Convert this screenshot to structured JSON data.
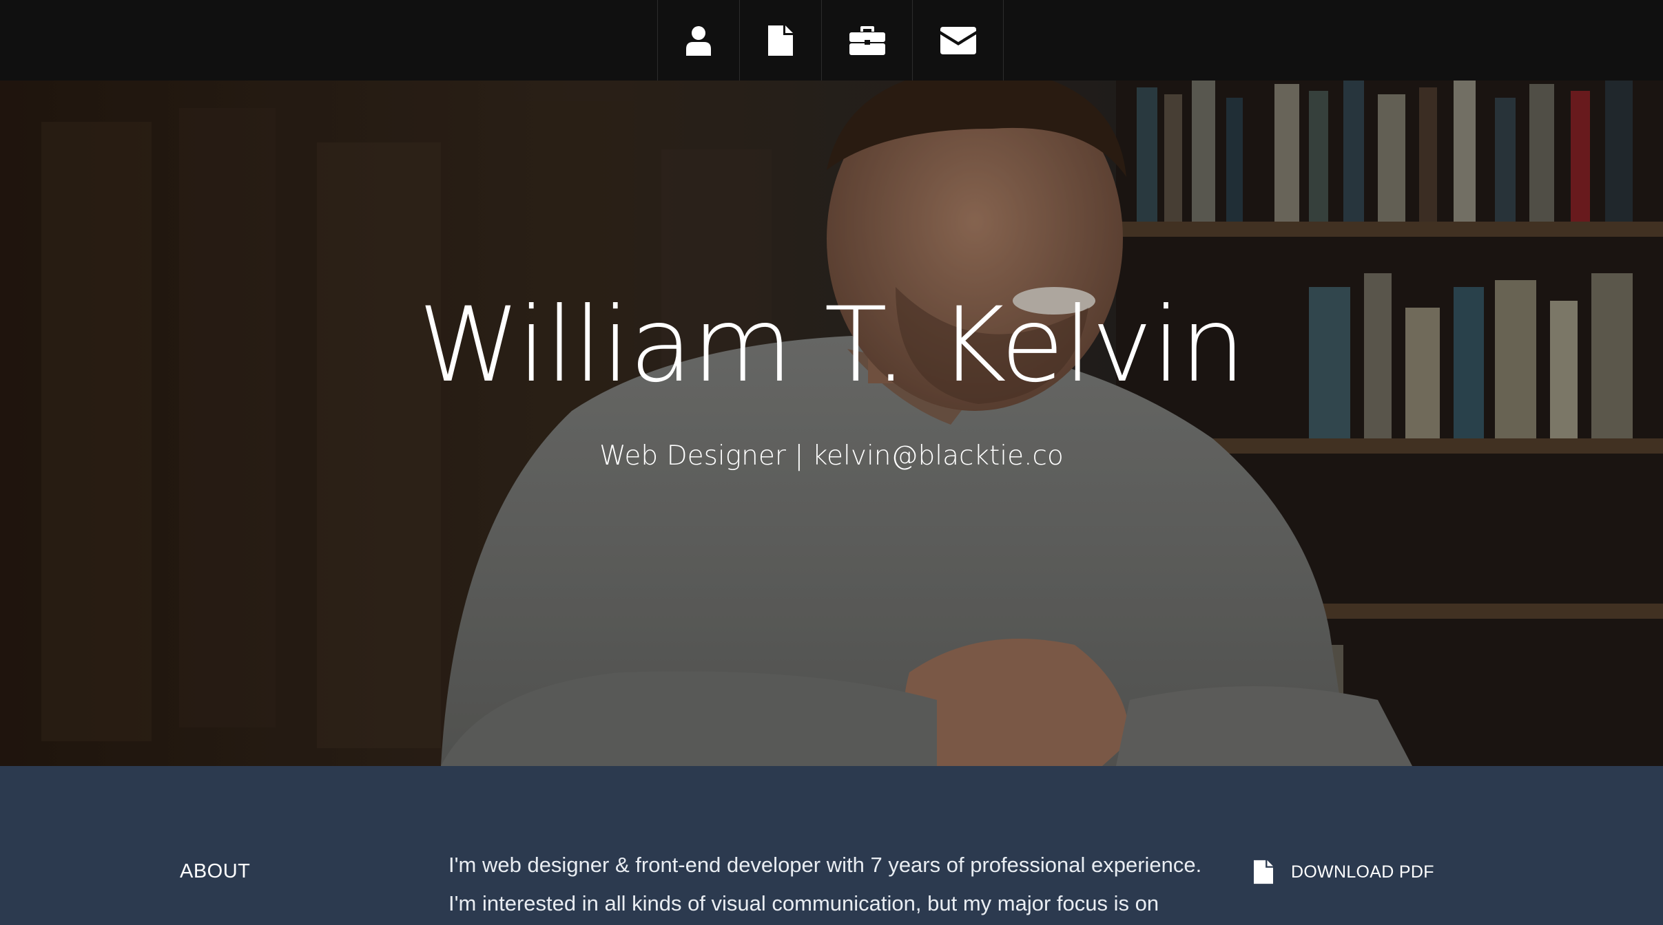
{
  "nav": {
    "items": [
      {
        "icon": "user-icon"
      },
      {
        "icon": "file-icon"
      },
      {
        "icon": "briefcase-icon"
      },
      {
        "icon": "envelope-icon"
      }
    ]
  },
  "hero": {
    "name": "William T. Kelvin",
    "subtitle": "Web Designer | kelvin@blacktie.co"
  },
  "about": {
    "label": "ABOUT",
    "paragraph_lines": [
      "I'm web designer & front-end developer with 7 years of professional experience.",
      "I'm interested in all kinds of visual communication, but my major focus is on"
    ],
    "download_label": "DOWNLOAD PDF",
    "download_icon": "file-icon"
  },
  "colors": {
    "nav_bg": "#101010",
    "about_bg": "#2c3a4f",
    "text": "#ffffff"
  }
}
